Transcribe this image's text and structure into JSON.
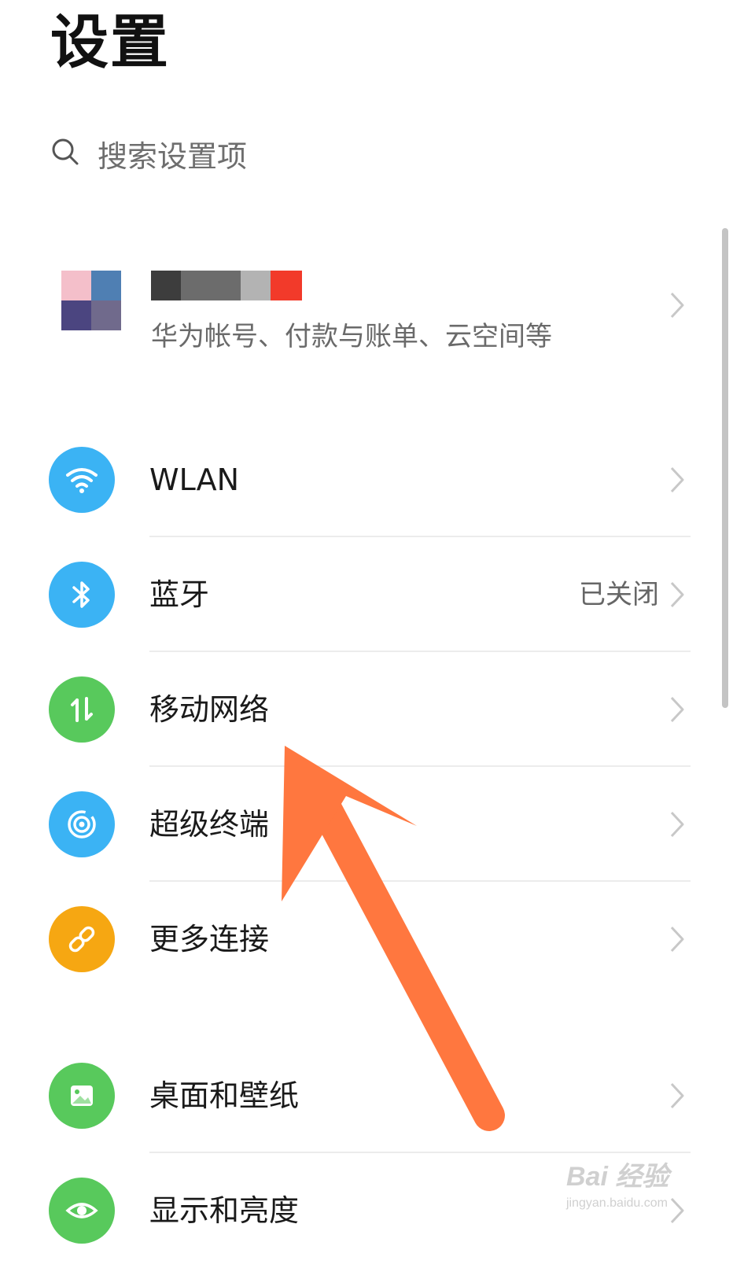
{
  "header": {
    "title": "设置"
  },
  "search": {
    "placeholder": "搜索设置项",
    "icon": "search-icon"
  },
  "account": {
    "subtitle": "华为帐号、付款与账单、云空间等",
    "name_pixels": [
      "#3d3d3d",
      "#6c6c6c",
      "#b3b3b3",
      "#f23a2a"
    ]
  },
  "items": [
    {
      "label": "WLAN",
      "status": "",
      "icon": "wifi-icon",
      "color": "#3bb3f4"
    },
    {
      "label": "蓝牙",
      "status": "已关闭",
      "icon": "bluetooth-icon",
      "color": "#3bb3f4"
    },
    {
      "label": "移动网络",
      "status": "",
      "icon": "mobile-data-icon",
      "color": "#58c95c"
    },
    {
      "label": "超级终端",
      "status": "",
      "icon": "super-device-icon",
      "color": "#3bb3f4"
    },
    {
      "label": "更多连接",
      "status": "",
      "icon": "link-icon",
      "color": "#f6a712"
    },
    {
      "label": "桌面和壁纸",
      "status": "",
      "icon": "wallpaper-icon",
      "color": "#58c95c"
    },
    {
      "label": "显示和亮度",
      "status": "",
      "icon": "eye-icon",
      "color": "#58c95c"
    }
  ],
  "annotation": {
    "arrow_color": "#ff773f"
  },
  "watermark": {
    "line1": "Bai 经验",
    "line2": "jingyan.baidu.com"
  }
}
